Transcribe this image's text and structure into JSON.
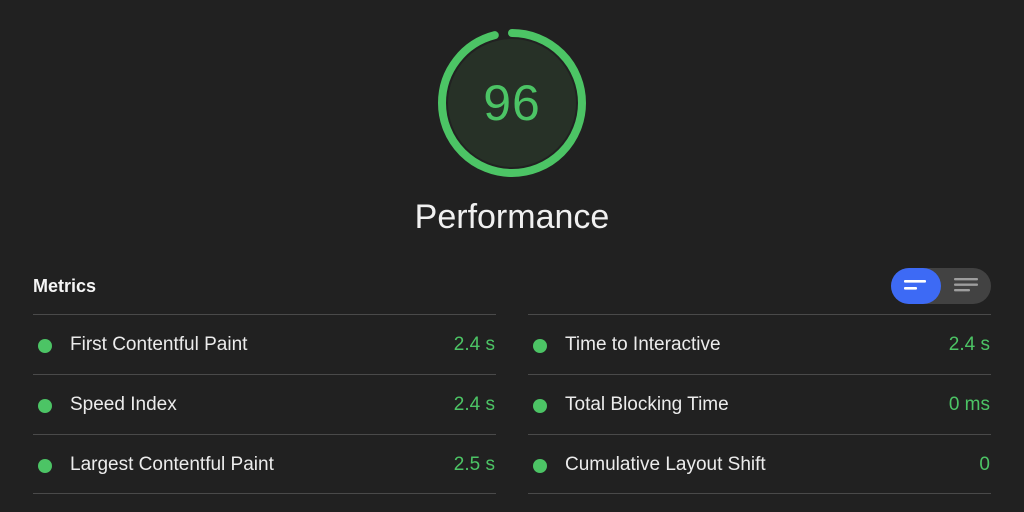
{
  "score": {
    "value": "96",
    "fraction": 0.96,
    "color": "#4cc465",
    "label": "Performance"
  },
  "metrics": {
    "title": "Metrics",
    "left": [
      {
        "label": "First Contentful Paint",
        "value": "2.4 s"
      },
      {
        "label": "Speed Index",
        "value": "2.4 s"
      },
      {
        "label": "Largest Contentful Paint",
        "value": "2.5 s"
      }
    ],
    "right": [
      {
        "label": "Time to Interactive",
        "value": "2.4 s"
      },
      {
        "label": "Total Blocking Time",
        "value": "0 ms"
      },
      {
        "label": "Cumulative Layout Shift",
        "value": "0"
      }
    ]
  },
  "view_toggle": {
    "options": [
      {
        "icon": "compact-view-icon",
        "selected": true
      },
      {
        "icon": "expanded-view-icon",
        "selected": false
      }
    ],
    "active_color": "#3d6af5"
  },
  "colors": {
    "background": "#212121",
    "pass": "#4cc465",
    "divider": "#4a4a4a"
  }
}
